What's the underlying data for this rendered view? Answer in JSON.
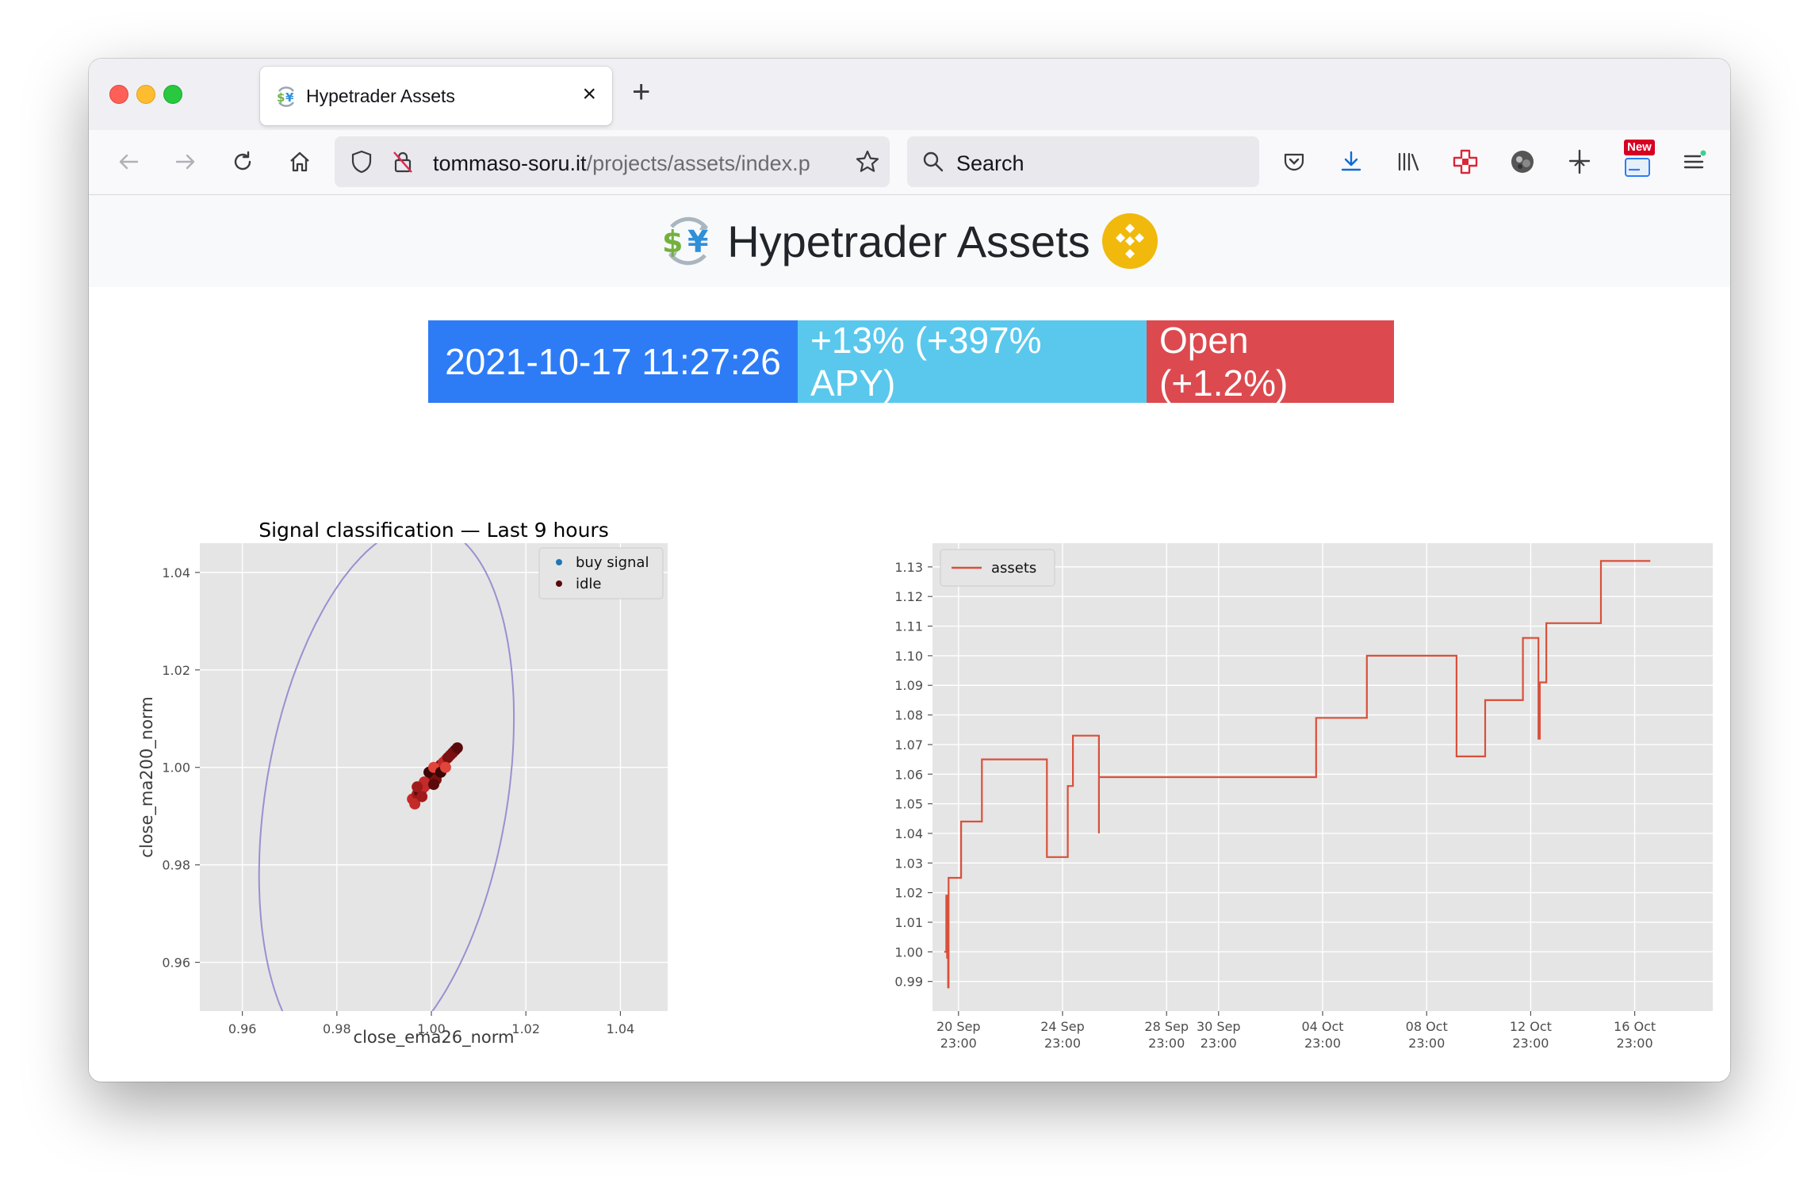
{
  "browser": {
    "tab_title": "Hypetrader Assets",
    "url_host": "tommaso-soru.it",
    "url_path": "/projects/assets/index.p",
    "search_placeholder": "Search",
    "new_badge": "New"
  },
  "page": {
    "title": "Hypetrader Assets",
    "stats": {
      "timestamp": "2021-10-17 11:27:26",
      "gain": "+13% (+397% APY)",
      "position": "Open (+1.2%)"
    }
  },
  "colors": {
    "date_bg": "#2d7cf6",
    "gain_bg": "#5ac8ec",
    "open_bg": "#dc4a4f",
    "assets_line": "#d9503a",
    "ellipse": "#9b8fd0",
    "plot_bg": "#e5e5e5"
  },
  "chart_data": [
    {
      "type": "scatter",
      "title": "Signal classification — Last 9 hours",
      "xlabel": "close_ema26_norm",
      "ylabel": "close_ma200_norm",
      "xlim": [
        0.951,
        1.05
      ],
      "ylim": [
        0.95,
        1.046
      ],
      "xticks": [
        "0.96",
        "0.98",
        "1.00",
        "1.02",
        "1.04"
      ],
      "yticks": [
        "0.96",
        "0.98",
        "1.00",
        "1.02",
        "1.04"
      ],
      "grid": true,
      "legend_position": "top-right",
      "series": [
        {
          "name": "buy signal",
          "color": "#1f77b4",
          "points": []
        },
        {
          "name": "idle",
          "color": "#5a0a0a",
          "points": [
            [
              0.996,
              0.9935
            ],
            [
              0.997,
              0.9945
            ],
            [
              0.998,
              0.9955
            ],
            [
              0.9975,
              0.995
            ],
            [
              0.999,
              0.9965
            ],
            [
              1.0,
              0.9975
            ],
            [
              0.9985,
              0.996
            ],
            [
              1.001,
              0.999
            ],
            [
              1.0,
              0.998
            ],
            [
              1.002,
              1.0005
            ],
            [
              1.0015,
              0.9995
            ],
            [
              1.003,
              1.0015
            ],
            [
              1.0025,
              1.001
            ],
            [
              1.004,
              1.0025
            ],
            [
              1.0035,
              1.002
            ],
            [
              1.005,
              1.0035
            ],
            [
              0.9995,
              0.999
            ],
            [
              1.0005,
              1.0
            ],
            [
              0.9985,
              0.997
            ],
            [
              0.997,
              0.996
            ],
            [
              1.001,
              0.9975
            ],
            [
              1.0005,
              0.9965
            ],
            [
              1.002,
              0.999
            ],
            [
              1.003,
              1.0
            ],
            [
              0.9965,
              0.9925
            ],
            [
              0.998,
              0.994
            ],
            [
              1.0045,
              1.003
            ],
            [
              1.0055,
              1.004
            ]
          ]
        }
      ],
      "boundary": {
        "type": "ellipse",
        "center": [
          0.9905,
          0.994
        ],
        "semi_axes": [
          0.0255,
          0.0565
        ],
        "rotation_deg": 10,
        "color": "#9b8fd0"
      }
    },
    {
      "type": "line",
      "title": "",
      "xlabel": "",
      "ylabel": "",
      "x_range_days": [
        -1.0,
        29.0
      ],
      "xticks": [
        {
          "day": 0,
          "label": [
            "20 Sep",
            "23:00"
          ]
        },
        {
          "day": 4,
          "label": [
            "24 Sep",
            "23:00"
          ]
        },
        {
          "day": 8,
          "label": [
            "28 Sep",
            "23:00"
          ]
        },
        {
          "day": 10,
          "label": [
            "30 Sep",
            "23:00"
          ]
        },
        {
          "day": 14,
          "label": [
            "04 Oct",
            "23:00"
          ]
        },
        {
          "day": 18,
          "label": [
            "08 Oct",
            "23:00"
          ]
        },
        {
          "day": 22,
          "label": [
            "12 Oct",
            "23:00"
          ]
        },
        {
          "day": 26,
          "label": [
            "16 Oct",
            "23:00"
          ]
        }
      ],
      "ylim": [
        0.98,
        1.138
      ],
      "yticks": [
        "0.99",
        "1.00",
        "1.01",
        "1.02",
        "1.03",
        "1.04",
        "1.05",
        "1.06",
        "1.07",
        "1.08",
        "1.09",
        "1.10",
        "1.11",
        "1.12",
        "1.13"
      ],
      "grid": true,
      "legend_position": "top-left",
      "series": [
        {
          "name": "assets",
          "color": "#d9503a",
          "step": true,
          "points": [
            [
              -0.55,
              1.0
            ],
            [
              -0.47,
              1.0
            ],
            [
              -0.47,
              1.019
            ],
            [
              -0.44,
              1.019
            ],
            [
              -0.44,
              0.998
            ],
            [
              -0.42,
              0.998
            ],
            [
              -0.42,
              1.006
            ],
            [
              -0.4,
              1.006
            ],
            [
              -0.4,
              0.988
            ],
            [
              -0.38,
              0.988
            ],
            [
              -0.38,
              1.025
            ],
            [
              0.1,
              1.025
            ],
            [
              0.1,
              1.044
            ],
            [
              0.9,
              1.044
            ],
            [
              0.9,
              1.065
            ],
            [
              3.4,
              1.065
            ],
            [
              3.4,
              1.032
            ],
            [
              4.2,
              1.032
            ],
            [
              4.2,
              1.056
            ],
            [
              4.4,
              1.056
            ],
            [
              4.4,
              1.073
            ],
            [
              5.4,
              1.073
            ],
            [
              5.4,
              1.04
            ],
            [
              5.4,
              1.059
            ],
            [
              13.75,
              1.059
            ],
            [
              13.75,
              1.079
            ],
            [
              15.7,
              1.079
            ],
            [
              15.7,
              1.1
            ],
            [
              19.15,
              1.1
            ],
            [
              19.15,
              1.066
            ],
            [
              20.25,
              1.066
            ],
            [
              20.25,
              1.085
            ],
            [
              21.7,
              1.085
            ],
            [
              21.7,
              1.106
            ],
            [
              22.3,
              1.106
            ],
            [
              22.3,
              1.072
            ],
            [
              22.35,
              1.072
            ],
            [
              22.35,
              1.091
            ],
            [
              22.6,
              1.091
            ],
            [
              22.6,
              1.111
            ],
            [
              24.7,
              1.111
            ],
            [
              24.7,
              1.132
            ],
            [
              26.6,
              1.132
            ]
          ]
        }
      ]
    }
  ]
}
